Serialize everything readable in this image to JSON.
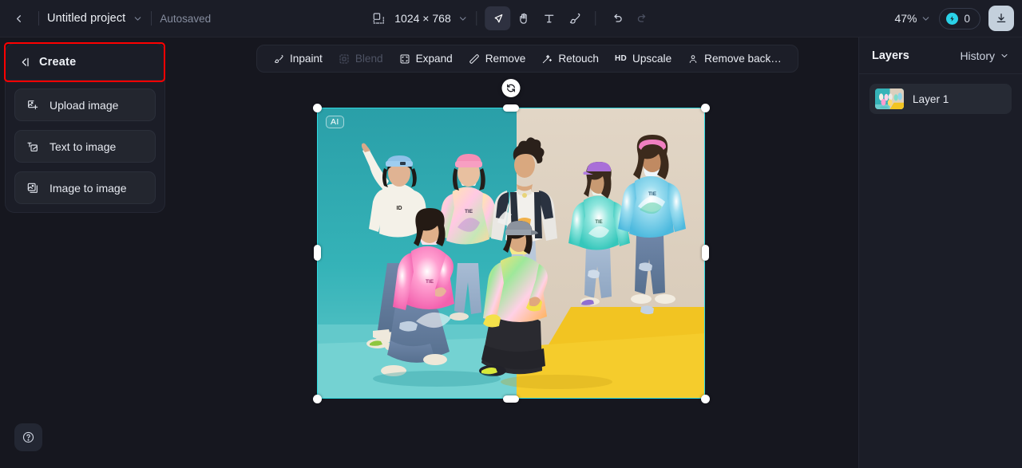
{
  "topbar": {
    "back_icon": "chevron-left-icon",
    "project_title": "Untitled project",
    "project_chevron": "chevron-down-icon",
    "autosaved_label": "Autosaved",
    "resize_icon": "resize-frame-icon",
    "canvas_dimensions": "1024 × 768",
    "dimensions_chevron": "chevron-down-icon",
    "tools": [
      {
        "name": "select-tool",
        "icon": "cursor-arrow-icon",
        "active": true
      },
      {
        "name": "pan-tool",
        "icon": "hand-icon",
        "active": false
      },
      {
        "name": "text-tool",
        "icon": "text-t-icon",
        "active": false
      },
      {
        "name": "brush-tool",
        "icon": "brush-icon",
        "active": false
      }
    ],
    "undo_icon": "undo-arrow-icon",
    "redo_icon": "redo-arrow-icon",
    "zoom_level": "47%",
    "zoom_chevron": "chevron-down-icon",
    "credits_icon": "credit-coin-icon",
    "credits_count": "0",
    "download_icon": "download-icon",
    "accent_color": "#2ad2e8",
    "download_bg": "#c4d0dc"
  },
  "create_panel": {
    "collapse_icon": "collapse-panel-icon",
    "title": "Create",
    "items": [
      {
        "label": "Upload image",
        "icon": "image-plus-icon",
        "highlighted": true
      },
      {
        "label": "Text to image",
        "icon": "text-to-image-icon",
        "highlighted": false
      },
      {
        "label": "Image to image",
        "icon": "image-to-image-icon",
        "highlighted": false
      }
    ],
    "highlight_color": "#ff0000"
  },
  "canvas_toolbar": {
    "items": [
      {
        "label": "Inpaint",
        "icon": "inpaint-brush-icon",
        "disabled": false
      },
      {
        "label": "Blend",
        "icon": "blend-frame-icon",
        "disabled": true
      },
      {
        "label": "Expand",
        "icon": "expand-frame-icon",
        "disabled": false
      },
      {
        "label": "Remove",
        "icon": "eraser-icon",
        "disabled": false
      },
      {
        "label": "Retouch",
        "icon": "retouch-wand-icon",
        "disabled": false
      },
      {
        "label": "Upscale",
        "icon": "hd-badge-icon",
        "disabled": false
      },
      {
        "label": "Remove back…",
        "icon": "remove-background-icon",
        "disabled": false
      }
    ]
  },
  "layers_panel": {
    "title": "Layers",
    "history_label": "History",
    "history_chevron": "chevron-down-icon",
    "layers": [
      {
        "name": "Layer 1",
        "thumbnail": "group-photo-thumbnail"
      }
    ]
  },
  "canvas": {
    "ai_badge": "AI",
    "selection_color": "#2fd9e0",
    "rotate_icon": "rotate-refresh-icon",
    "image_description": "Seven young people in colorful tie-dye streetwear posing against a teal and beige studio backdrop with a yellow floor panel"
  },
  "help": {
    "icon": "question-mark-icon"
  }
}
